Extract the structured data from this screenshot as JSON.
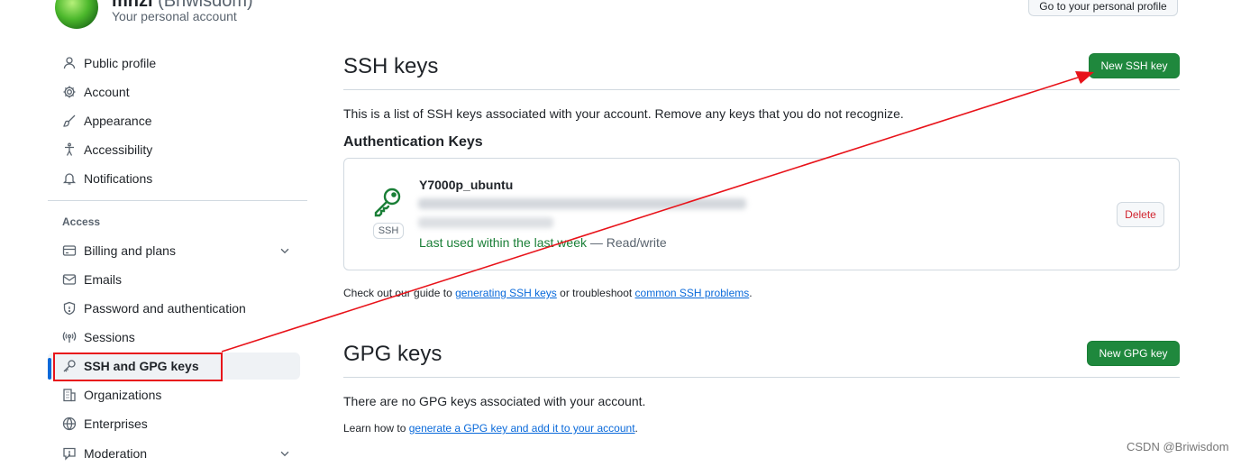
{
  "header": {
    "username": "mhzl",
    "handle": "(Briwisdom)",
    "subtitle": "Your personal account",
    "profile_button": "Go to your personal profile"
  },
  "sidebar": {
    "items_top": [
      {
        "label": "Public profile",
        "icon": "person-icon"
      },
      {
        "label": "Account",
        "icon": "gear-icon"
      },
      {
        "label": "Appearance",
        "icon": "paintbrush-icon"
      },
      {
        "label": "Accessibility",
        "icon": "accessibility-icon"
      },
      {
        "label": "Notifications",
        "icon": "bell-icon"
      }
    ],
    "access_heading": "Access",
    "items_access": [
      {
        "label": "Billing and plans",
        "icon": "credit-card-icon"
      },
      {
        "label": "Emails",
        "icon": "mail-icon"
      },
      {
        "label": "Password and authentication",
        "icon": "shield-icon"
      },
      {
        "label": "Sessions",
        "icon": "broadcast-icon"
      },
      {
        "label": "SSH and GPG keys",
        "icon": "key-icon"
      },
      {
        "label": "Organizations",
        "icon": "organization-icon"
      },
      {
        "label": "Enterprises",
        "icon": "globe-icon"
      },
      {
        "label": "Moderation",
        "icon": "report-icon"
      }
    ]
  },
  "ssh": {
    "title": "SSH keys",
    "new_button": "New SSH key",
    "description": "This is a list of SSH keys associated with your account. Remove any keys that you do not recognize.",
    "auth_heading": "Authentication Keys",
    "key": {
      "name": "Y7000p_ubuntu",
      "type_badge": "SSH",
      "last_used": "Last used within the last week",
      "access": " — Read/write",
      "delete_button": "Delete"
    },
    "guide_prefix": "Check out our guide to ",
    "guide_link": "generating SSH keys",
    "guide_mid": " or troubleshoot ",
    "guide_link2": "common SSH problems",
    "guide_suffix": "."
  },
  "gpg": {
    "title": "GPG keys",
    "new_button": "New GPG key",
    "empty_text": "There are no GPG keys associated with your account.",
    "learn_prefix": "Learn how to ",
    "learn_link": "generate a GPG key and add it to your account",
    "learn_suffix": "."
  },
  "watermark": "CSDN @Briwisdom",
  "colors": {
    "accent": "#0969da",
    "primary_button": "#1f883d",
    "danger": "#d1242f",
    "annotation": "#e8131a"
  }
}
